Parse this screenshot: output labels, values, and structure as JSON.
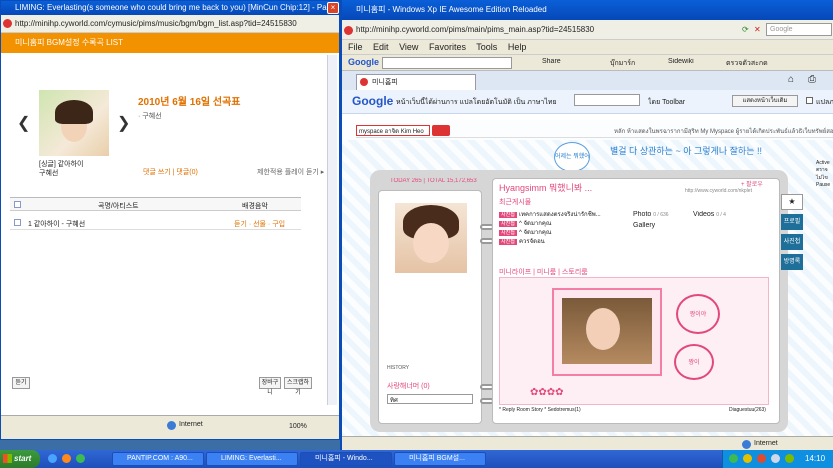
{
  "left_window": {
    "title": "LIMING: Everlasting(s someone who could bring me back to you) [MinCun Chip:12] - Page U",
    "address": "http://minihp.cyworld.com/cymusic/pims/music/bgm/bgm_list.asp?tid=24515830",
    "header": "미니홈피 BGM설정 수록곡 LIST",
    "date_title": "2010년 6월 16일 선곡표",
    "artist": "· 구혜선",
    "album_label": "[싱글] 같아하이",
    "album_artist": "구혜선",
    "action_links": "댓글 쓰기 | 댓글(0)",
    "action_right": "제한적용 플레이 듣기 ▸",
    "col_song": "곡명/아티스트",
    "col_bg": "배경음악",
    "song_row": "1  같아하이 - 구혜선",
    "song_actions": "듣기 · 선물 · 구입",
    "btn_left": "듣기",
    "btn_right1": "장바구니",
    "btn_right2": "스크랩하기",
    "status_text": "Internet",
    "zoom": "100%"
  },
  "right_window": {
    "title": "미니홈피 - Windows Xp IE Awesome Edition Reloaded",
    "address": "http://minihp.cyworld.com/pims/main/pims_main.asp?tid=24515830",
    "menu": [
      "File",
      "Edit",
      "View",
      "Favorites",
      "Tools",
      "Help"
    ],
    "search_placeholder": "Google",
    "google_toolbar_label": "Google",
    "toolbar_items": [
      "Share",
      "บุ๊กมาร์ก",
      "Sidewiki",
      "ตรวจตัวสะกด"
    ],
    "tab_label": "미니홈피",
    "translate_text": "หน้าเว็บนี้ได้ผ่านการ แปลโดยอัตโนมัติ เป็น ภาษาไทย",
    "translate_toolbar": "ไดย Toolbar",
    "translate_button": "แสดงหน้าเว็บเดิม",
    "translate_cb": "แปลภาษ",
    "myspace_input": "myspace อาจิด Kim Heo",
    "myspace_nav": "หลัก  ห้าแสดงในพรฉารากามีสุริท  My Myspace  ผู้รายได้เกิดประพันธ์แล้วธิเว็บทรัพย์สอด",
    "handwriting": "별걸 다 상관하는 ~ 아 그렇게나 잘하는 !!",
    "speech_bubble": "어제는 뭐했어?",
    "today": "TODAY 265 | TOTAL 15,172,653",
    "profile_name": "Hyangsimm 뭐했니봐 ...",
    "profile_link": "+ 팔로우",
    "profile_url": "http://www.cyworld.com/nkplet",
    "recent_header": "최근게시물",
    "posts": [
      "เทคการแสดงตรงจริงน่ารักชีพ...",
      "^ จัดมากคุณ",
      "^ จัดมากคุณ",
      "ควรจัดอน"
    ],
    "post_tag": "사진첩",
    "photo_label": "Photo",
    "photo_count": "0 / 636",
    "video_label": "Videos",
    "video_count": "0 / 4",
    "gallery_label": "Gallery",
    "mini_tabs": "미니라이프 | 미니룸 | 스토리룸",
    "history_label": "HISTORY",
    "friends_label": "사랑해너머 (0)",
    "select_label": "ทิศ",
    "footer_left": "* Reply Room Story  * Sedotremus(1)",
    "footer_right": "Diaguestuu(263)",
    "side_tabs": [
      "프로필",
      "사진첩",
      "방명록"
    ],
    "status_text": "Internet",
    "sticker1": "짱이야",
    "sticker2": "짱이"
  },
  "taskbar": {
    "start": "start",
    "items": [
      "PANTIP.COM : A90...",
      "LIMING: Everlasti...",
      "미니홈피 - Windo...",
      "미니홈피 BGM설..."
    ],
    "clock": "14:10"
  },
  "far_right_fragments": [
    "Active",
    "ตราจ",
    "ไม่ไข",
    "Pause"
  ]
}
